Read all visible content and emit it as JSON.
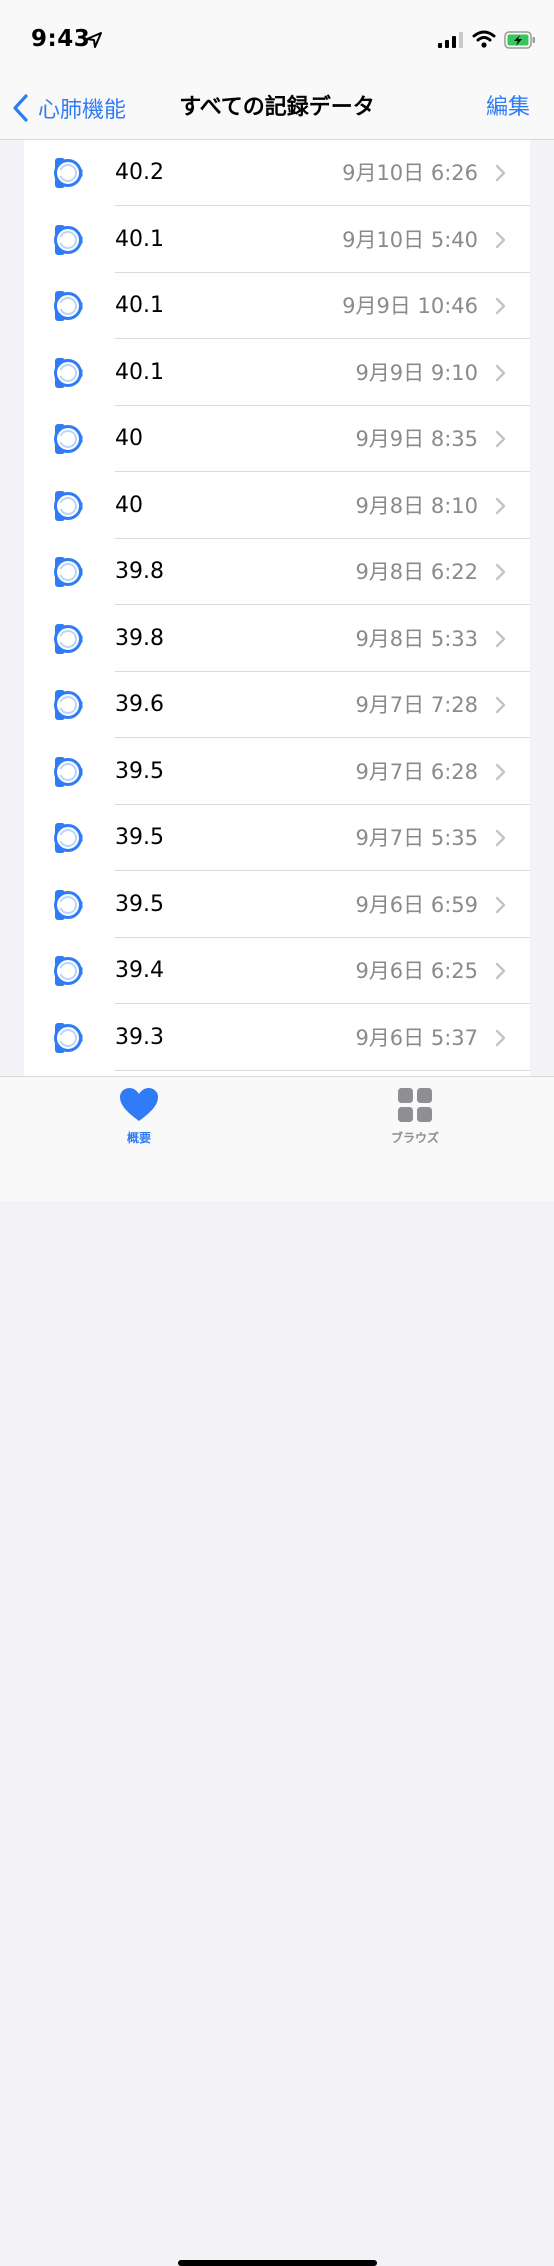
{
  "status_bar": {
    "time": "9:43"
  },
  "nav": {
    "back_label": "心肺機能",
    "title": "すべての記録データ",
    "edit_label": "編集"
  },
  "colors": {
    "accent": "#2f7cf6",
    "secondary_text": "#8a8a8e",
    "background": "#f2f2f7"
  },
  "records": [
    {
      "value": "40.2",
      "date": "9月10日 6:26",
      "icon": "apple-watch-icon"
    },
    {
      "value": "40.1",
      "date": "9月10日 5:40",
      "icon": "apple-watch-icon"
    },
    {
      "value": "40.1",
      "date": "9月9日 10:46",
      "icon": "apple-watch-icon"
    },
    {
      "value": "40.1",
      "date": "9月9日 9:10",
      "icon": "apple-watch-icon"
    },
    {
      "value": "40",
      "date": "9月9日 8:35",
      "icon": "apple-watch-icon"
    },
    {
      "value": "40",
      "date": "9月8日 8:10",
      "icon": "apple-watch-icon"
    },
    {
      "value": "39.8",
      "date": "9月8日 6:22",
      "icon": "apple-watch-icon"
    },
    {
      "value": "39.8",
      "date": "9月8日 5:33",
      "icon": "apple-watch-icon"
    },
    {
      "value": "39.6",
      "date": "9月7日 7:28",
      "icon": "apple-watch-icon"
    },
    {
      "value": "39.5",
      "date": "9月7日 6:28",
      "icon": "apple-watch-icon"
    },
    {
      "value": "39.5",
      "date": "9月7日 5:35",
      "icon": "apple-watch-icon"
    },
    {
      "value": "39.5",
      "date": "9月6日 6:59",
      "icon": "apple-watch-icon"
    },
    {
      "value": "39.4",
      "date": "9月6日 6:25",
      "icon": "apple-watch-icon"
    },
    {
      "value": "39.3",
      "date": "9月6日 5:37",
      "icon": "apple-watch-icon"
    }
  ],
  "tab_bar": {
    "tabs": [
      {
        "label": "概要",
        "icon": "heart-icon",
        "selected": true
      },
      {
        "label": "ブラウズ",
        "icon": "grid-icon",
        "selected": false
      }
    ]
  }
}
